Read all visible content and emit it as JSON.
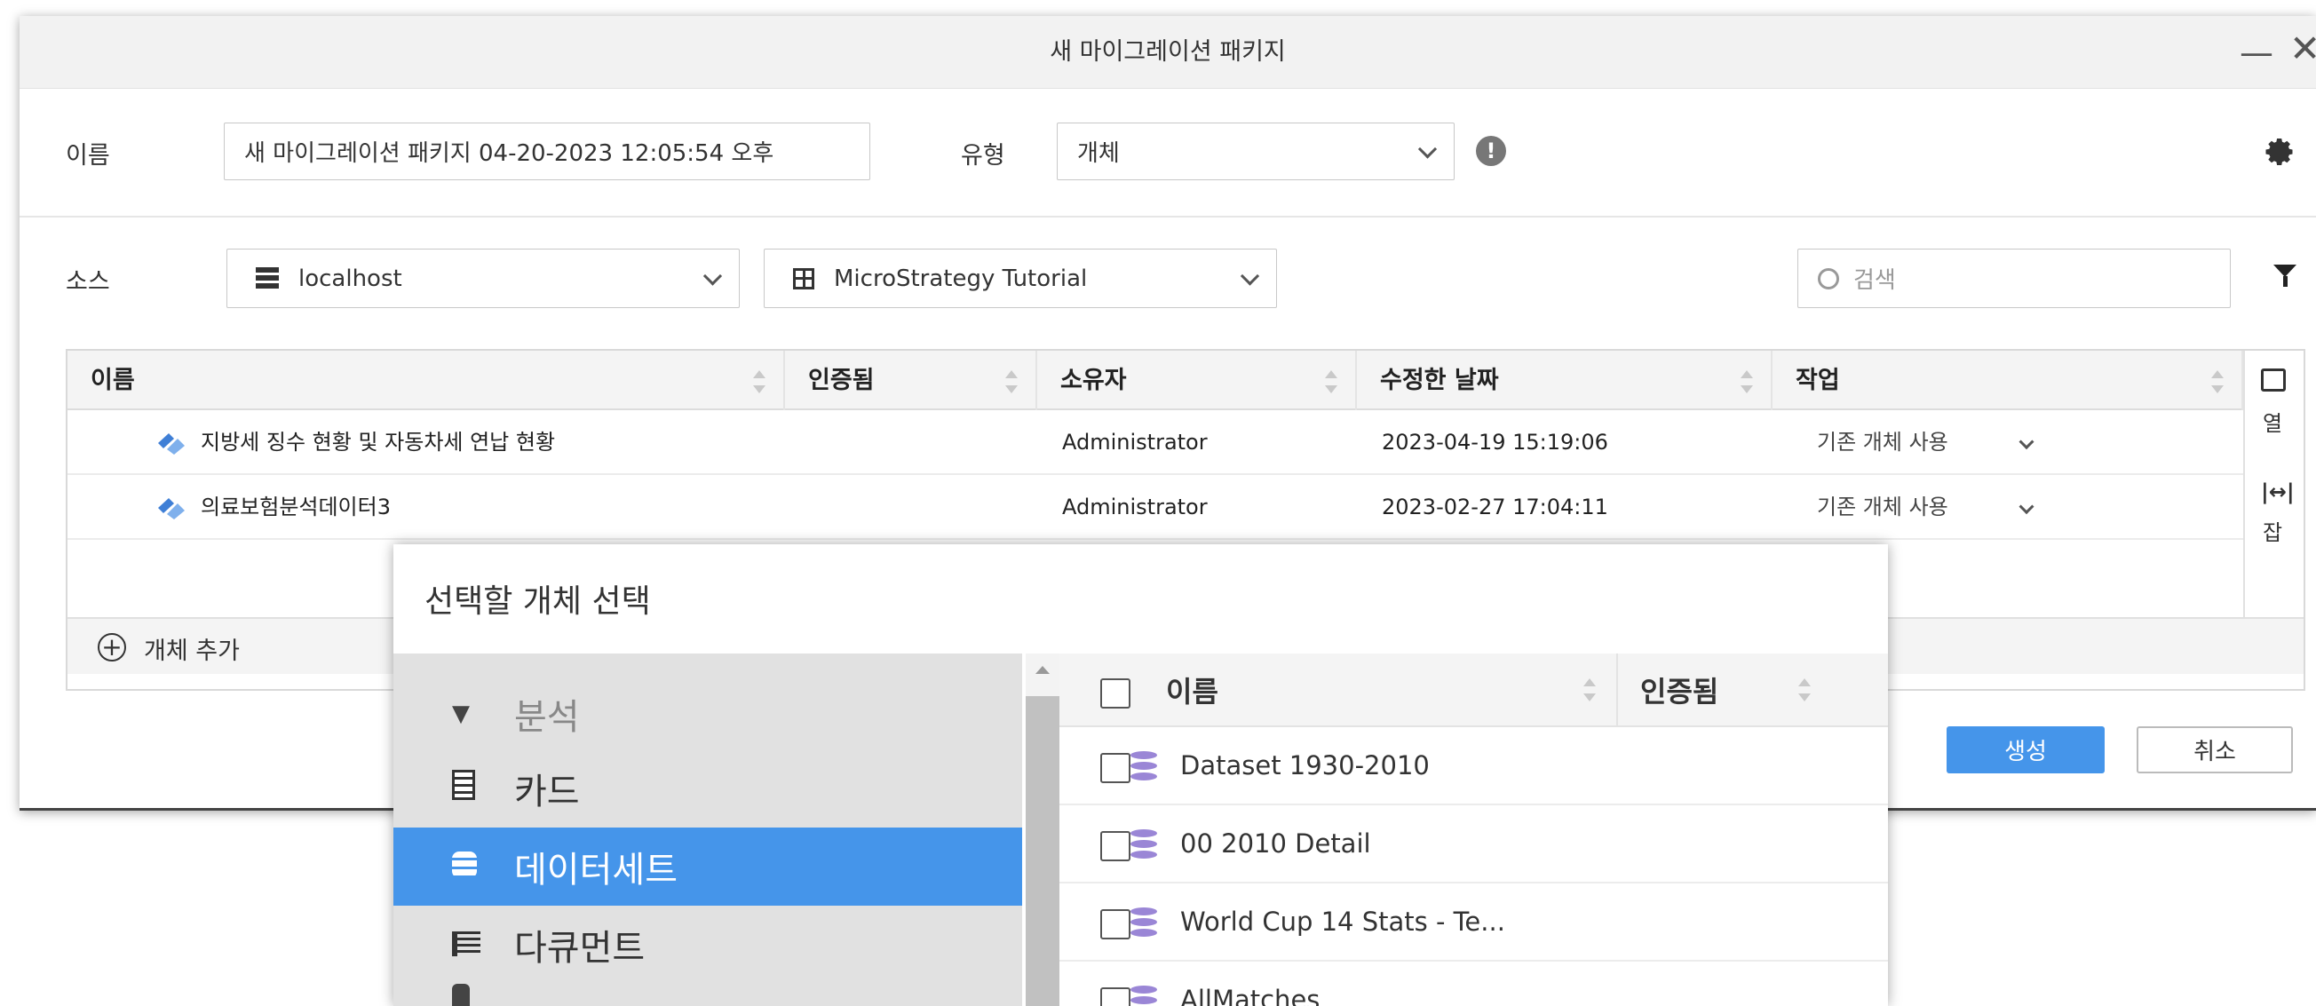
{
  "window": {
    "title": "새 마이그레이션 패키지"
  },
  "form": {
    "name_label": "이름",
    "name_value": "새 마이그레이션 패키지 04-20-2023 12:05:54 오후",
    "type_label": "유형",
    "type_value": "개체",
    "source_label": "소스",
    "server_value": "localhost",
    "project_value": "MicroStrategy Tutorial",
    "search_placeholder": "검색"
  },
  "grid": {
    "columns": [
      "이름",
      "인증됨",
      "소유자",
      "수정한 날짜",
      "작업"
    ],
    "rows": [
      {
        "name": "지방세 징수 현황 및 자동차세 연납 현황",
        "certified": "",
        "owner": "Administrator",
        "modified": "2023-04-19 15:19:06",
        "action": "기존 개체 사용"
      },
      {
        "name": "의료보험분석데이터3",
        "certified": "",
        "owner": "Administrator",
        "modified": "2023-02-27 17:04:11",
        "action": "기존 개체 사용"
      }
    ],
    "side_columns_label": "열",
    "side_fit_label": "잡",
    "add_object_label": "개체 추가"
  },
  "buttons": {
    "create": "생성",
    "cancel": "취소"
  },
  "picker": {
    "title": "선택할 개체 선택",
    "tree": [
      {
        "label": "분석",
        "icon": "caret-down-icon"
      },
      {
        "label": "카드",
        "icon": "card-icon"
      },
      {
        "label": "데이터세트",
        "icon": "database-icon"
      },
      {
        "label": "다큐먼트",
        "icon": "document-icon"
      }
    ],
    "columns": [
      "이름",
      "인증됨"
    ],
    "items": [
      "Dataset 1930-2010",
      "00 2010 Detail",
      "World Cup 14 Stats - Te...",
      "AllMatches"
    ]
  },
  "colors": {
    "accent": "#4595ea",
    "selected_bg": "#4595ea",
    "dataset_icon": "#9a86d6",
    "object_icon": "#3f7fd6"
  }
}
